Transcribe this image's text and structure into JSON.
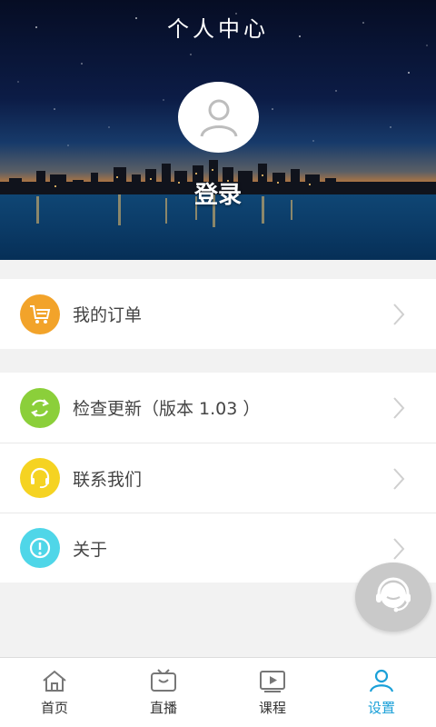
{
  "header": {
    "title": "个人中心",
    "login_label": "登录",
    "avatar_icon": "user-icon"
  },
  "menu": {
    "orders": {
      "label": "我的订单",
      "icon": "cart-icon",
      "color": "#f2a32a"
    },
    "update": {
      "label": "检查更新（版本 1.03 ）",
      "icon": "refresh-icon",
      "color": "#8bcf3a"
    },
    "contact": {
      "label": "联系我们",
      "icon": "headset-icon",
      "color": "#f5d322"
    },
    "about": {
      "label": "关于",
      "icon": "info-icon",
      "color": "#4fd6e8"
    }
  },
  "fab": {
    "icon": "customer-service-icon"
  },
  "tabbar": {
    "items": [
      {
        "label": "首页",
        "icon": "home-icon",
        "active": false
      },
      {
        "label": "直播",
        "icon": "tv-icon",
        "active": false
      },
      {
        "label": "课程",
        "icon": "play-icon",
        "active": false
      },
      {
        "label": "设置",
        "icon": "user-icon",
        "active": true
      }
    ],
    "active_color": "#1aa0d8"
  }
}
